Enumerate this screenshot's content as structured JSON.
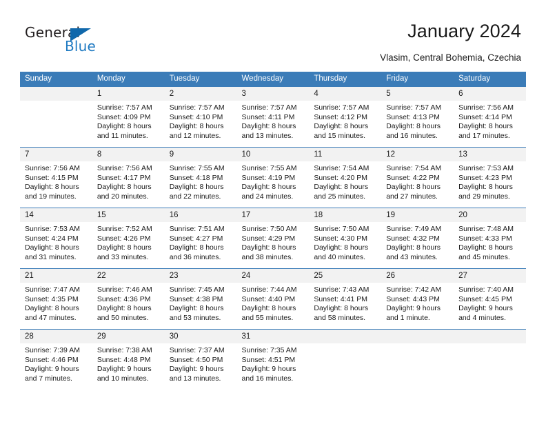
{
  "brand": {
    "name_part1": "General",
    "name_part2": "Blue",
    "accent_color": "#1f7ac2",
    "triangle_color": "#1068ab"
  },
  "header": {
    "title": "January 2024",
    "location": "Vlasim, Central Bohemia, Czechia"
  },
  "calendar": {
    "header_bg": "#3b7cb8",
    "daynum_bg": "#f2f2f2",
    "weekday_headers": [
      "Sunday",
      "Monday",
      "Tuesday",
      "Wednesday",
      "Thursday",
      "Friday",
      "Saturday"
    ],
    "weeks": [
      [
        {
          "day": "",
          "sunrise": "",
          "sunset": "",
          "daylight1": "",
          "daylight2": ""
        },
        {
          "day": "1",
          "sunrise": "Sunrise: 7:57 AM",
          "sunset": "Sunset: 4:09 PM",
          "daylight1": "Daylight: 8 hours",
          "daylight2": "and 11 minutes."
        },
        {
          "day": "2",
          "sunrise": "Sunrise: 7:57 AM",
          "sunset": "Sunset: 4:10 PM",
          "daylight1": "Daylight: 8 hours",
          "daylight2": "and 12 minutes."
        },
        {
          "day": "3",
          "sunrise": "Sunrise: 7:57 AM",
          "sunset": "Sunset: 4:11 PM",
          "daylight1": "Daylight: 8 hours",
          "daylight2": "and 13 minutes."
        },
        {
          "day": "4",
          "sunrise": "Sunrise: 7:57 AM",
          "sunset": "Sunset: 4:12 PM",
          "daylight1": "Daylight: 8 hours",
          "daylight2": "and 15 minutes."
        },
        {
          "day": "5",
          "sunrise": "Sunrise: 7:57 AM",
          "sunset": "Sunset: 4:13 PM",
          "daylight1": "Daylight: 8 hours",
          "daylight2": "and 16 minutes."
        },
        {
          "day": "6",
          "sunrise": "Sunrise: 7:56 AM",
          "sunset": "Sunset: 4:14 PM",
          "daylight1": "Daylight: 8 hours",
          "daylight2": "and 17 minutes."
        }
      ],
      [
        {
          "day": "7",
          "sunrise": "Sunrise: 7:56 AM",
          "sunset": "Sunset: 4:15 PM",
          "daylight1": "Daylight: 8 hours",
          "daylight2": "and 19 minutes."
        },
        {
          "day": "8",
          "sunrise": "Sunrise: 7:56 AM",
          "sunset": "Sunset: 4:17 PM",
          "daylight1": "Daylight: 8 hours",
          "daylight2": "and 20 minutes."
        },
        {
          "day": "9",
          "sunrise": "Sunrise: 7:55 AM",
          "sunset": "Sunset: 4:18 PM",
          "daylight1": "Daylight: 8 hours",
          "daylight2": "and 22 minutes."
        },
        {
          "day": "10",
          "sunrise": "Sunrise: 7:55 AM",
          "sunset": "Sunset: 4:19 PM",
          "daylight1": "Daylight: 8 hours",
          "daylight2": "and 24 minutes."
        },
        {
          "day": "11",
          "sunrise": "Sunrise: 7:54 AM",
          "sunset": "Sunset: 4:20 PM",
          "daylight1": "Daylight: 8 hours",
          "daylight2": "and 25 minutes."
        },
        {
          "day": "12",
          "sunrise": "Sunrise: 7:54 AM",
          "sunset": "Sunset: 4:22 PM",
          "daylight1": "Daylight: 8 hours",
          "daylight2": "and 27 minutes."
        },
        {
          "day": "13",
          "sunrise": "Sunrise: 7:53 AM",
          "sunset": "Sunset: 4:23 PM",
          "daylight1": "Daylight: 8 hours",
          "daylight2": "and 29 minutes."
        }
      ],
      [
        {
          "day": "14",
          "sunrise": "Sunrise: 7:53 AM",
          "sunset": "Sunset: 4:24 PM",
          "daylight1": "Daylight: 8 hours",
          "daylight2": "and 31 minutes."
        },
        {
          "day": "15",
          "sunrise": "Sunrise: 7:52 AM",
          "sunset": "Sunset: 4:26 PM",
          "daylight1": "Daylight: 8 hours",
          "daylight2": "and 33 minutes."
        },
        {
          "day": "16",
          "sunrise": "Sunrise: 7:51 AM",
          "sunset": "Sunset: 4:27 PM",
          "daylight1": "Daylight: 8 hours",
          "daylight2": "and 36 minutes."
        },
        {
          "day": "17",
          "sunrise": "Sunrise: 7:50 AM",
          "sunset": "Sunset: 4:29 PM",
          "daylight1": "Daylight: 8 hours",
          "daylight2": "and 38 minutes."
        },
        {
          "day": "18",
          "sunrise": "Sunrise: 7:50 AM",
          "sunset": "Sunset: 4:30 PM",
          "daylight1": "Daylight: 8 hours",
          "daylight2": "and 40 minutes."
        },
        {
          "day": "19",
          "sunrise": "Sunrise: 7:49 AM",
          "sunset": "Sunset: 4:32 PM",
          "daylight1": "Daylight: 8 hours",
          "daylight2": "and 43 minutes."
        },
        {
          "day": "20",
          "sunrise": "Sunrise: 7:48 AM",
          "sunset": "Sunset: 4:33 PM",
          "daylight1": "Daylight: 8 hours",
          "daylight2": "and 45 minutes."
        }
      ],
      [
        {
          "day": "21",
          "sunrise": "Sunrise: 7:47 AM",
          "sunset": "Sunset: 4:35 PM",
          "daylight1": "Daylight: 8 hours",
          "daylight2": "and 47 minutes."
        },
        {
          "day": "22",
          "sunrise": "Sunrise: 7:46 AM",
          "sunset": "Sunset: 4:36 PM",
          "daylight1": "Daylight: 8 hours",
          "daylight2": "and 50 minutes."
        },
        {
          "day": "23",
          "sunrise": "Sunrise: 7:45 AM",
          "sunset": "Sunset: 4:38 PM",
          "daylight1": "Daylight: 8 hours",
          "daylight2": "and 53 minutes."
        },
        {
          "day": "24",
          "sunrise": "Sunrise: 7:44 AM",
          "sunset": "Sunset: 4:40 PM",
          "daylight1": "Daylight: 8 hours",
          "daylight2": "and 55 minutes."
        },
        {
          "day": "25",
          "sunrise": "Sunrise: 7:43 AM",
          "sunset": "Sunset: 4:41 PM",
          "daylight1": "Daylight: 8 hours",
          "daylight2": "and 58 minutes."
        },
        {
          "day": "26",
          "sunrise": "Sunrise: 7:42 AM",
          "sunset": "Sunset: 4:43 PM",
          "daylight1": "Daylight: 9 hours",
          "daylight2": "and 1 minute."
        },
        {
          "day": "27",
          "sunrise": "Sunrise: 7:40 AM",
          "sunset": "Sunset: 4:45 PM",
          "daylight1": "Daylight: 9 hours",
          "daylight2": "and 4 minutes."
        }
      ],
      [
        {
          "day": "28",
          "sunrise": "Sunrise: 7:39 AM",
          "sunset": "Sunset: 4:46 PM",
          "daylight1": "Daylight: 9 hours",
          "daylight2": "and 7 minutes."
        },
        {
          "day": "29",
          "sunrise": "Sunrise: 7:38 AM",
          "sunset": "Sunset: 4:48 PM",
          "daylight1": "Daylight: 9 hours",
          "daylight2": "and 10 minutes."
        },
        {
          "day": "30",
          "sunrise": "Sunrise: 7:37 AM",
          "sunset": "Sunset: 4:50 PM",
          "daylight1": "Daylight: 9 hours",
          "daylight2": "and 13 minutes."
        },
        {
          "day": "31",
          "sunrise": "Sunrise: 7:35 AM",
          "sunset": "Sunset: 4:51 PM",
          "daylight1": "Daylight: 9 hours",
          "daylight2": "and 16 minutes."
        },
        {
          "day": "",
          "sunrise": "",
          "sunset": "",
          "daylight1": "",
          "daylight2": ""
        },
        {
          "day": "",
          "sunrise": "",
          "sunset": "",
          "daylight1": "",
          "daylight2": ""
        },
        {
          "day": "",
          "sunrise": "",
          "sunset": "",
          "daylight1": "",
          "daylight2": ""
        }
      ]
    ]
  }
}
